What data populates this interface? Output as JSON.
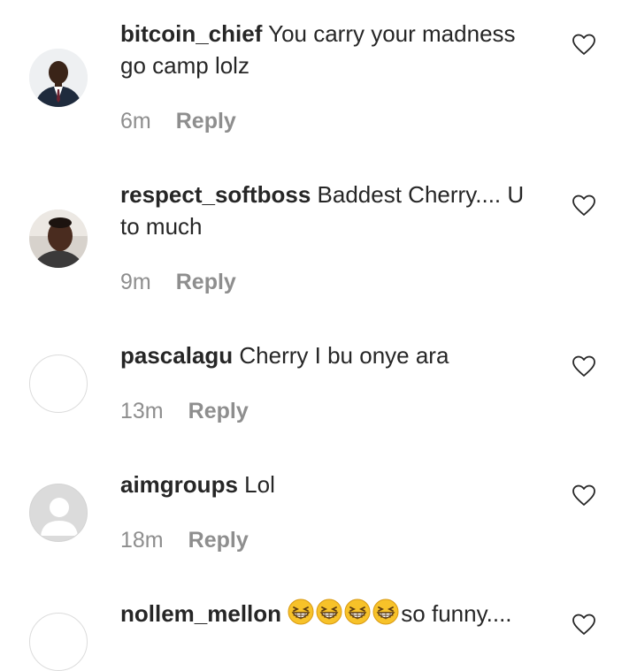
{
  "comments": [
    {
      "username": "bitcoin_chief",
      "text": "You carry your madness go camp lolz",
      "time": "6m",
      "reply": "Reply"
    },
    {
      "username": "respect_softboss",
      "text": "Baddest Cherry.... U to much",
      "time": "9m",
      "reply": "Reply"
    },
    {
      "username": "pascalagu",
      "text": "Cherry I bu onye ara",
      "time": "13m",
      "reply": "Reply"
    },
    {
      "username": "aimgroups",
      "text": "Lol",
      "time": "18m",
      "reply": "Reply"
    },
    {
      "username": "nollem_mellon",
      "text": "so funny....",
      "emoji_count": 4
    }
  ],
  "icons": {
    "like": "heart-outline-icon",
    "emoji": "grinning-squinting-face-emoji"
  },
  "colors": {
    "text": "#262626",
    "secondary": "#8e8e8e",
    "avatar_placeholder": "#dbdbdb"
  }
}
